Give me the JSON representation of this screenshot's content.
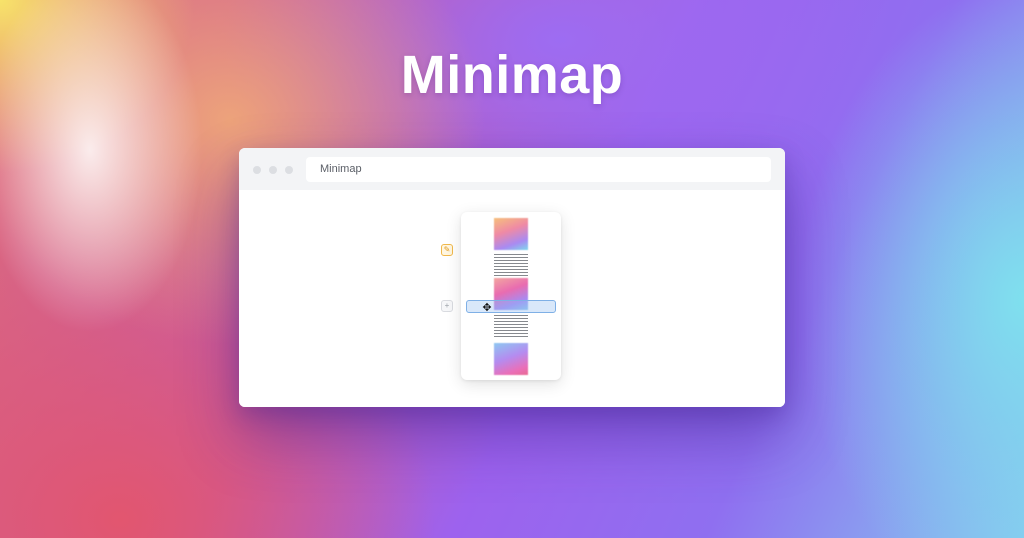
{
  "page": {
    "headline": "Minimap"
  },
  "window": {
    "url_text": "Minimap",
    "controls": [
      "close-dot",
      "minimize-dot",
      "maximize-dot"
    ]
  },
  "toolbar": {
    "compass_icon": "compass-icon",
    "add_icon": "plus-icon",
    "compass_glyph": "✎",
    "add_glyph": "+"
  },
  "minimap": {
    "cursor_glyph": "✥",
    "thumbnails": [
      "gradient-image-1",
      "gradient-image-2",
      "gradient-image-3"
    ]
  },
  "colors": {
    "accent_orange": "#f0b84b",
    "viewport_border": "#7fb0e6"
  }
}
